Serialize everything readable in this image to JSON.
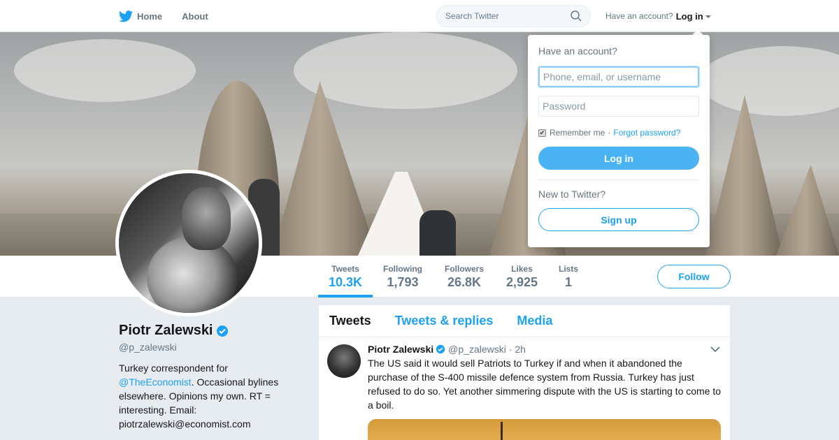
{
  "nav": {
    "home_label": "Home",
    "about_label": "About",
    "search_placeholder": "Search Twitter",
    "have_account_text": "Have an account?",
    "login_label": "Log in"
  },
  "profile": {
    "name": "Piotr Zalewski",
    "handle": "@p_zalewski",
    "bio_prefix": "Turkey correspondent for",
    "bio_link": "@TheEconomist",
    "bio_suffix": ". Occasional bylines elsewhere. Opinions my own. RT = interesting. Email: piotrzalewski@economist.com",
    "follow_label": "Follow"
  },
  "stats": [
    {
      "label": "Tweets",
      "value": "10.3K"
    },
    {
      "label": "Following",
      "value": "1,793"
    },
    {
      "label": "Followers",
      "value": "26.8K"
    },
    {
      "label": "Likes",
      "value": "2,925"
    },
    {
      "label": "Lists",
      "value": "1"
    }
  ],
  "timeline": {
    "tabs": [
      "Tweets",
      "Tweets & replies",
      "Media"
    ],
    "tweet": {
      "name": "Piotr Zalewski",
      "handle": "@p_zalewski",
      "time": "· 2h",
      "text": "The US said it would sell Patriots to Turkey if and when it abandoned the purchase of the S-400 missile defence system from Russia. Turkey has just refused to do so. Yet another simmering dispute with the US is starting to come to a boil."
    }
  },
  "login_dropdown": {
    "title": "Have an account?",
    "username_placeholder": "Phone, email, or username",
    "password_placeholder": "Password",
    "remember_label": "Remember me",
    "separator": "·",
    "forgot_label": "Forgot password?",
    "login_button": "Log in",
    "new_text": "New to Twitter?",
    "signup_button": "Sign up"
  },
  "colors": {
    "accent": "#1da1f2",
    "login_button": "#4ab3f4",
    "background": "#e6ecf0"
  }
}
